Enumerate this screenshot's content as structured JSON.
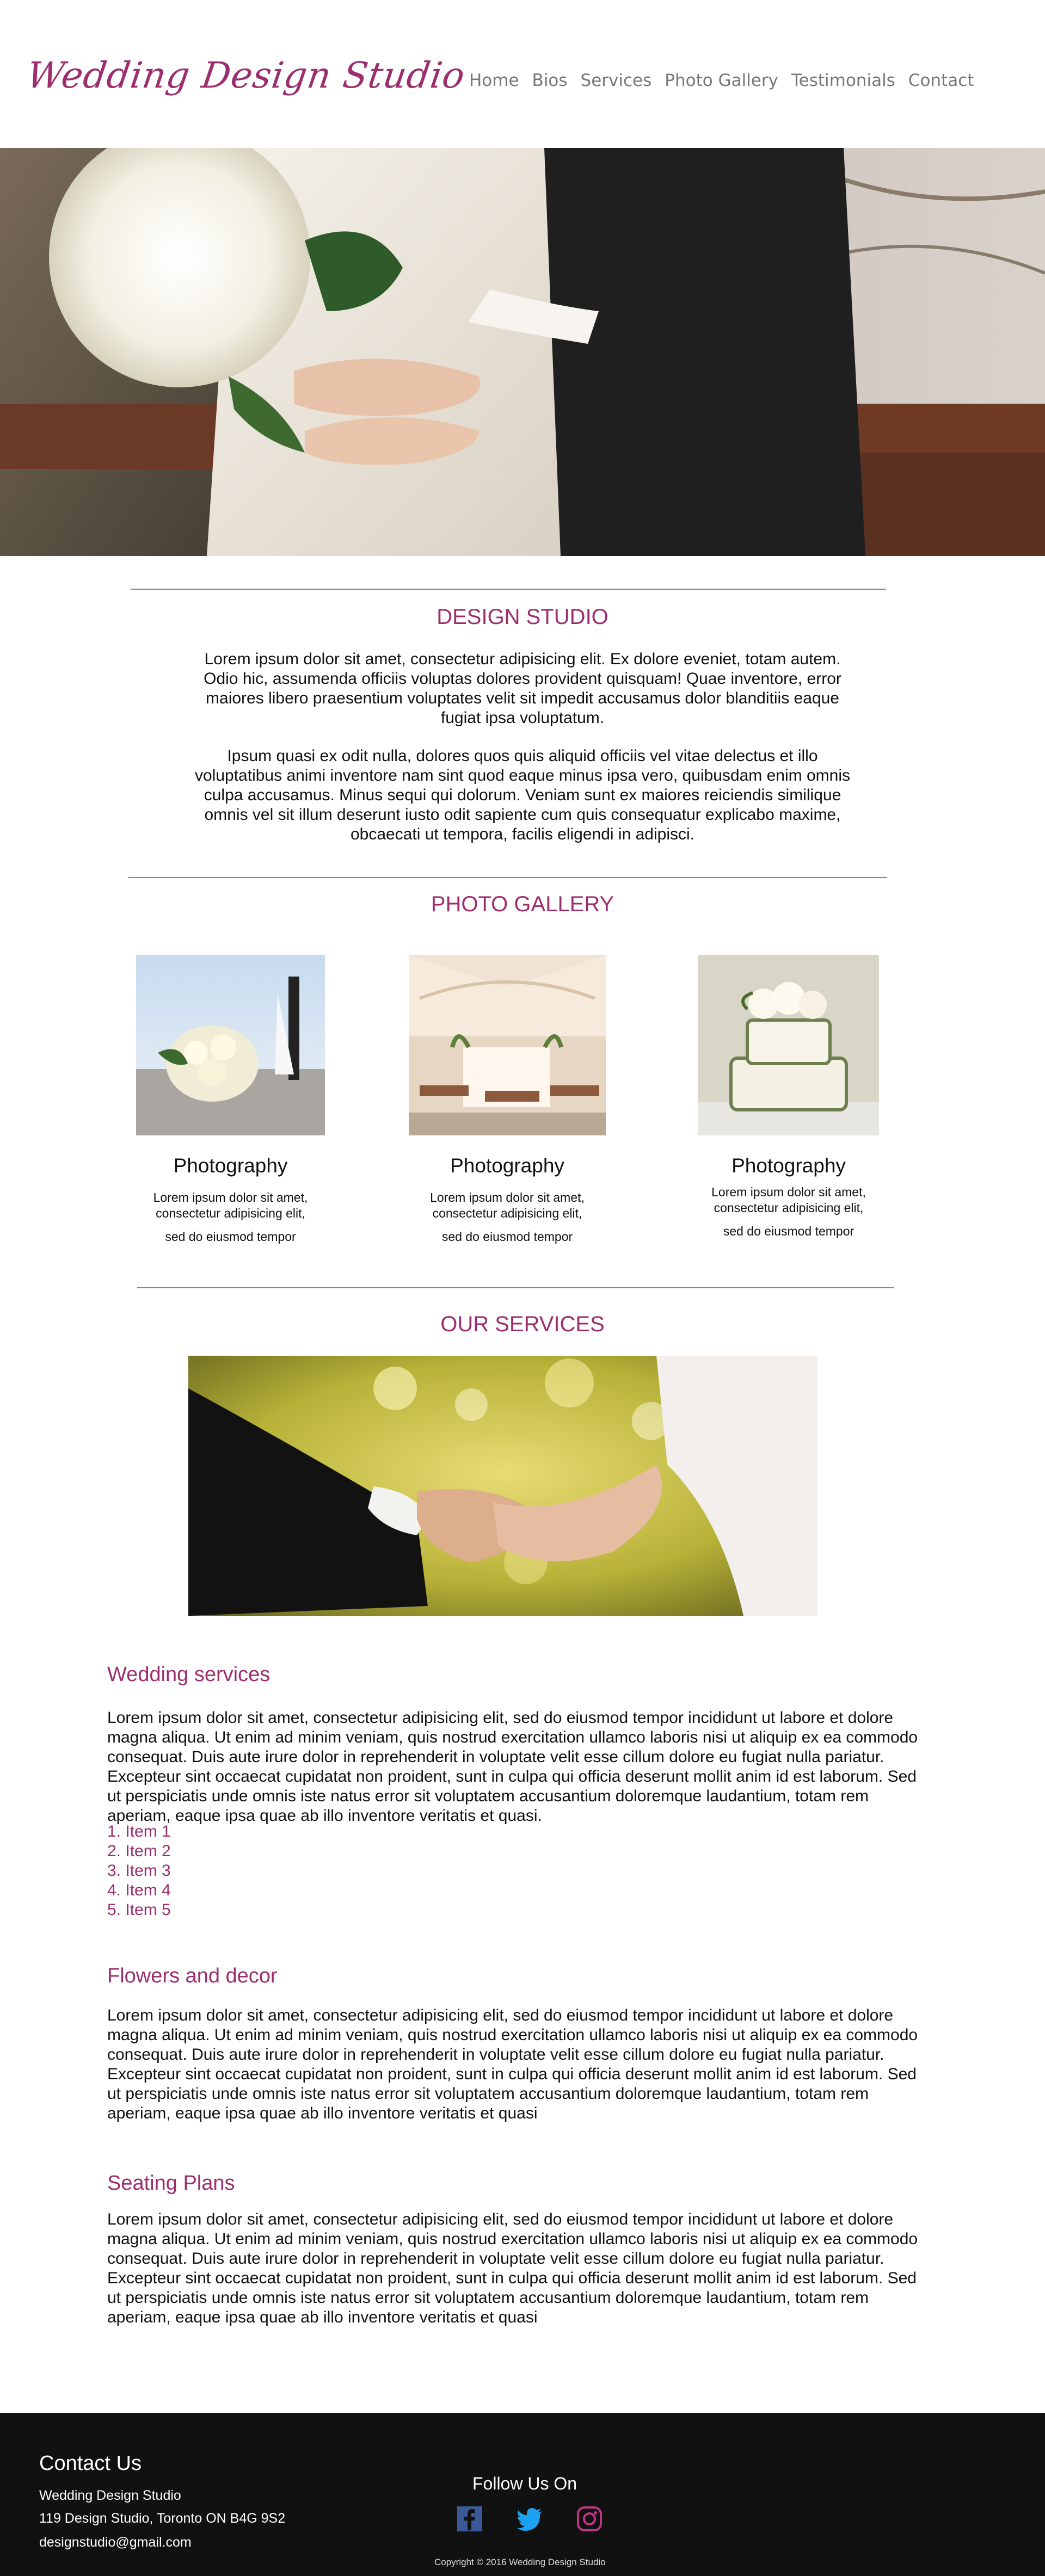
{
  "header": {
    "logo": "Wedding Design Studio",
    "nav": [
      "Home",
      "Bios",
      "Services",
      "Photo Gallery",
      "Testimonials",
      "Contact"
    ]
  },
  "design": {
    "title": "DESIGN STUDIO",
    "para1": "Lorem ipsum dolor sit amet, consectetur adipisicing elit. Ex dolore eveniet, totam autem. Odio hic, assumenda officiis voluptas dolores provident quisquam! Quae inventore, error maiores libero praesentium voluptates velit sit impedit accusamus dolor blanditiis eaque fugiat ipsa voluptatum.",
    "para2": "Ipsum quasi ex odit nulla, dolores quos quis aliquid officiis vel vitae delectus et illo voluptatibus animi inventore nam sint quod eaque minus ipsa vero, quibusdam enim omnis culpa accusamus. Minus sequi qui dolorum. Veniam sunt ex maiores reiciendis similique omnis vel sit illum deserunt iusto odit sapiente cum quis consequatur explicabo maxime, obcaecati ut tempora, facilis eligendi in adipisci."
  },
  "gallery": {
    "title": "PHOTO GALLERY",
    "items": [
      {
        "caption": "Photography",
        "text1": "Lorem ipsum dolor sit amet,",
        "text2": "consectetur adipisicing elit,",
        "text3": "sed  do eiusmod tempor"
      },
      {
        "caption": "Photography",
        "text1": "Lorem ipsum dolor sit amet,",
        "text2": "consectetur adipisicing elit,",
        "text3": "sed  do eiusmod tempor"
      },
      {
        "caption": "Photography",
        "text1": "Lorem ipsum dolor sit amet,",
        "text2": "consectetur adipisicing elit,",
        "text3": "sed  do eiusmod tempor"
      }
    ]
  },
  "services": {
    "title": "OUR SERVICES",
    "wedding_heading": "Wedding services",
    "wedding_text": "Lorem ipsum dolor sit amet, consectetur adipisicing elit, sed do eiusmod tempor incididunt ut labore et dolore magna aliqua. Ut enim ad minim veniam, quis nostrud exercitation ullamco laboris nisi ut aliquip ex ea commodo consequat. Duis aute irure dolor in reprehenderit in voluptate velit esse cillum dolore eu fugiat nulla pariatur. Excepteur sint occaecat cupidatat non proident, sunt in culpa qui officia deserunt mollit anim id est laborum. Sed ut perspiciatis unde omnis iste natus error sit voluptatem accusantium doloremque laudantium, totam rem aperiam, eaque ipsa quae ab illo inventore veritatis et quasi.",
    "items": [
      "1.   Item 1",
      "2.  Item 2",
      "3. Item 3",
      "4. Item 4",
      "5.  Item 5"
    ],
    "flowers_heading": "Flowers and decor",
    "flowers_text": "Lorem ipsum dolor sit amet, consectetur adipisicing elit, sed do eiusmod tempor incididunt ut labore et dolore magna aliqua. Ut enim ad minim veniam, quis nostrud exercitation ullamco laboris nisi ut aliquip ex ea commodo consequat. Duis aute irure dolor in reprehenderit in voluptate velit esse cillum dolore eu fugiat nulla pariatur. Excepteur sint occaecat cupidatat non proident, sunt in culpa qui officia deserunt mollit anim id est laborum. Sed ut perspiciatis unde omnis iste natus error sit voluptatem accusantium doloremque laudantium, totam rem aperiam, eaque ipsa quae ab illo inventore veritatis et quasi",
    "seating_heading": "Seating Plans",
    "seating_text": "Lorem ipsum dolor sit amet, consectetur adipisicing elit, sed do eiusmod tempor incididunt ut labore et dolore magna aliqua. Ut enim ad minim veniam, quis nostrud exercitation ullamco laboris nisi ut aliquip ex ea commodo consequat. Duis aute irure dolor in reprehenderit in voluptate velit esse cillum dolore eu fugiat nulla pariatur. Excepteur sint occaecat cupidatat non proident, sunt in culpa qui officia deserunt mollit anim id est laborum. Sed ut perspiciatis unde omnis iste natus error sit voluptatem accusantium doloremque laudantium, totam rem aperiam, eaque ipsa quae ab illo inventore veritatis et quasi"
  },
  "footer": {
    "contact_title": "Contact Us",
    "studio": "Wedding Design Studio",
    "address": "119 Design Studio, Toronto ON B4G 9S2",
    "email": "designstudio@gmail.com",
    "follow": "Follow Us On",
    "social": [
      "facebook-icon",
      "twitter-icon",
      "instagram-icon"
    ],
    "copyright": "Copyright © 2016 Wedding Design Studio"
  },
  "colors": {
    "accent": "#9c2e6d",
    "footer_bg": "#111111",
    "nav_text": "#777777",
    "facebook": "#3b5998",
    "twitter": "#1da1f2",
    "instagram": "#c13584"
  }
}
